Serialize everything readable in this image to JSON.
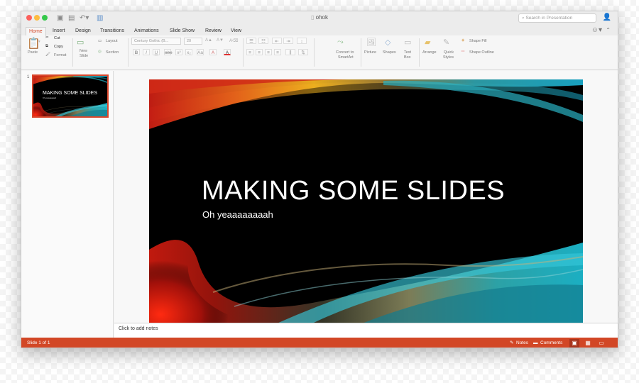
{
  "window": {
    "title": "ohok",
    "search_placeholder": "Search in Presentation"
  },
  "tabs": [
    {
      "label": "Home",
      "active": true
    },
    {
      "label": "Insert"
    },
    {
      "label": "Design"
    },
    {
      "label": "Transitions"
    },
    {
      "label": "Animations"
    },
    {
      "label": "Slide Show"
    },
    {
      "label": "Review"
    },
    {
      "label": "View"
    }
  ],
  "ribbon": {
    "paste": "Paste",
    "cut": "Cut",
    "copy": "Copy",
    "format": "Format",
    "new_slide_1": "New",
    "new_slide_2": "Slide",
    "layout": "Layout",
    "section": "Section",
    "font_name": "Century Gothic (B...",
    "font_size": "20",
    "convert_1": "Convert to",
    "convert_2": "SmartArt",
    "picture": "Picture",
    "shapes": "Shapes",
    "textbox_1": "Text",
    "textbox_2": "Box",
    "arrange": "Arrange",
    "quick_1": "Quick",
    "quick_2": "Styles",
    "shape_fill": "Shape Fill",
    "shape_outline": "Shape Outline"
  },
  "thumbnail": {
    "number": "1",
    "title": "MAKING SOME SLIDES",
    "subtitle": "Oh yeaaaaaaaah"
  },
  "slide": {
    "title": "MAKING SOME SLIDES",
    "subtitle": "Oh yeaaaaaaaah"
  },
  "notes_placeholder": "Click to add notes",
  "status": {
    "slide_count": "Slide 1 of 1",
    "notes": "Notes",
    "comments": "Comments"
  },
  "colors": {
    "accent": "#d24726",
    "slide_bg": "#000000"
  },
  "icons": [
    "save-icon",
    "open-icon",
    "undo-icon",
    "sidebar-toggle-icon",
    "search-icon",
    "add-user-icon",
    "smiley-icon",
    "chevron-down-icon",
    "cut-icon",
    "copy-icon",
    "format-painter-icon",
    "paste-icon"
  ]
}
